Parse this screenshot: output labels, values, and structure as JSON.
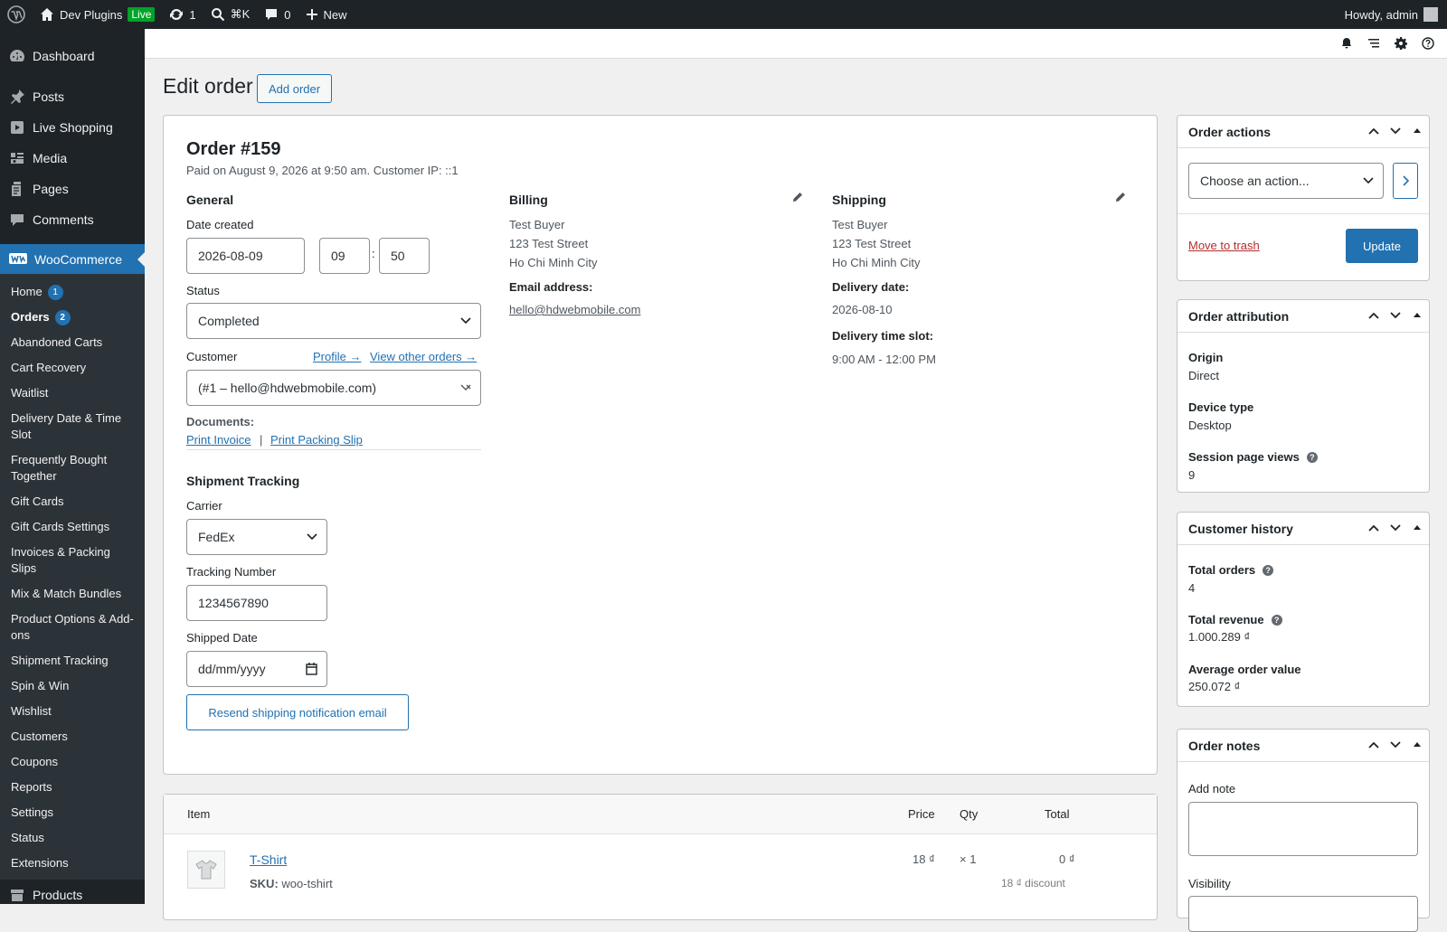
{
  "admin_bar": {
    "site_name": "Dev Plugins",
    "live_badge": "Live",
    "updates_count": "1",
    "search_shortcut": "⌘K",
    "comments_count": "0",
    "new_label": "New",
    "howdy": "Howdy, admin"
  },
  "sidebar": {
    "top_items": [
      {
        "label": "Dashboard",
        "icon": "dashboard-icon"
      },
      {
        "label": "Posts",
        "icon": "pin-icon"
      },
      {
        "label": "Live Shopping",
        "icon": "video-icon"
      },
      {
        "label": "Media",
        "icon": "media-icon"
      },
      {
        "label": "Pages",
        "icon": "page-icon"
      },
      {
        "label": "Comments",
        "icon": "comment-icon"
      }
    ],
    "woocommerce_label": "WooCommerce",
    "sub_items": [
      {
        "label": "Home",
        "badge": "1"
      },
      {
        "label": "Orders",
        "badge": "2",
        "current": true
      },
      {
        "label": "Abandoned Carts"
      },
      {
        "label": "Cart Recovery"
      },
      {
        "label": "Waitlist"
      },
      {
        "label": "Delivery Date & Time Slot"
      },
      {
        "label": "Frequently Bought Together"
      },
      {
        "label": "Gift Cards"
      },
      {
        "label": "Gift Cards Settings"
      },
      {
        "label": "Invoices & Packing Slips"
      },
      {
        "label": "Mix & Match Bundles"
      },
      {
        "label": "Product Options & Add-ons"
      },
      {
        "label": "Shipment Tracking"
      },
      {
        "label": "Spin & Win"
      },
      {
        "label": "Wishlist"
      },
      {
        "label": "Customers"
      },
      {
        "label": "Coupons"
      },
      {
        "label": "Reports"
      },
      {
        "label": "Settings"
      },
      {
        "label": "Status"
      },
      {
        "label": "Extensions"
      }
    ],
    "products_label": "Products"
  },
  "page": {
    "title": "Edit order",
    "add_order_label": "Add order"
  },
  "order": {
    "heading": "Order #159",
    "meta": "Paid on August 9, 2026 at 9:50 am. Customer IP: ::1",
    "general": {
      "heading": "General",
      "date_created_label": "Date created",
      "date": "2026-08-09",
      "hour": "09",
      "time_sep": ":",
      "minute": "50",
      "status_label": "Status",
      "status_value": "Completed",
      "customer_label": "Customer",
      "profile_link": "Profile →",
      "view_other_orders_link": "View other orders →",
      "customer_value": "(#1 – hello@hdwebmobile.com)",
      "documents_label": "Documents:",
      "print_invoice": "Print Invoice",
      "doc_sep": "|",
      "print_packing_slip": "Print Packing Slip"
    },
    "billing": {
      "heading": "Billing",
      "name": "Test Buyer",
      "street": "123 Test Street",
      "city": "Ho Chi Minh City",
      "email_label": "Email address:",
      "email": "hello@hdwebmobile.com"
    },
    "shipping": {
      "heading": "Shipping",
      "name": "Test Buyer",
      "street": "123 Test Street",
      "city": "Ho Chi Minh City",
      "delivery_date_label": "Delivery date:",
      "delivery_date": "2026-08-10",
      "delivery_slot_label": "Delivery time slot:",
      "delivery_slot": "9:00 AM - 12:00 PM"
    },
    "tracking": {
      "heading": "Shipment Tracking",
      "carrier_label": "Carrier",
      "carrier_value": "FedEx",
      "tracking_number_label": "Tracking Number",
      "tracking_number": "1234567890",
      "shipped_date_label": "Shipped Date",
      "shipped_date_placeholder": "dd/mm/yyyy",
      "resend_label": "Resend shipping notification email"
    }
  },
  "items": {
    "headers": {
      "item": "Item",
      "price": "Price",
      "qty": "Qty",
      "total": "Total"
    },
    "rows": [
      {
        "name": "T-Shirt",
        "sku_label": "SKU:",
        "sku": "woo-tshirt",
        "price": "18 ₫",
        "qty": "× 1",
        "total": "0 ₫",
        "discount": "18 ₫ discount"
      }
    ]
  },
  "order_actions": {
    "title": "Order actions",
    "select_value": "Choose an action...",
    "trash_label": "Move to trash",
    "update_label": "Update"
  },
  "order_attribution": {
    "title": "Order attribution",
    "origin_label": "Origin",
    "origin": "Direct",
    "device_label": "Device type",
    "device": "Desktop",
    "pageviews_label": "Session page views",
    "pageviews": "9"
  },
  "customer_history": {
    "title": "Customer history",
    "total_orders_label": "Total orders",
    "total_orders": "4",
    "total_revenue_label": "Total revenue",
    "total_revenue": "1.000.289 ₫",
    "aov_label": "Average order value",
    "aov": "250.072 ₫"
  },
  "order_notes": {
    "title": "Order notes",
    "add_note_label": "Add note",
    "visibility_label": "Visibility"
  }
}
